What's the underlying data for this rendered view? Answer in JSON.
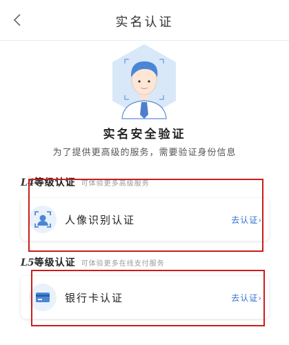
{
  "header": {
    "title": "实名认证",
    "back_icon": "chevron-left-icon"
  },
  "hero": {
    "avatar_icon": "user-avatar-icon",
    "title": "实名安全验证",
    "subtitle": "为了提供更高级的服务，需要验证身份信息"
  },
  "sections": [
    {
      "level": "L4",
      "level_name": "等级认证",
      "description": "可体验更多高级服务",
      "card": {
        "icon": "face-scan-icon",
        "label": "人像识别认证",
        "action": "去认证›"
      }
    },
    {
      "level": "L5",
      "level_name": "等级认证",
      "description": "可体验更多在线支付服务",
      "card": {
        "icon": "bank-card-icon",
        "label": "银行卡认证",
        "action": "去认证›"
      }
    }
  ],
  "colors": {
    "accent": "#2f6fce",
    "highlight_box": "#cc1b1b",
    "icon_background": "#e9f1fb"
  }
}
